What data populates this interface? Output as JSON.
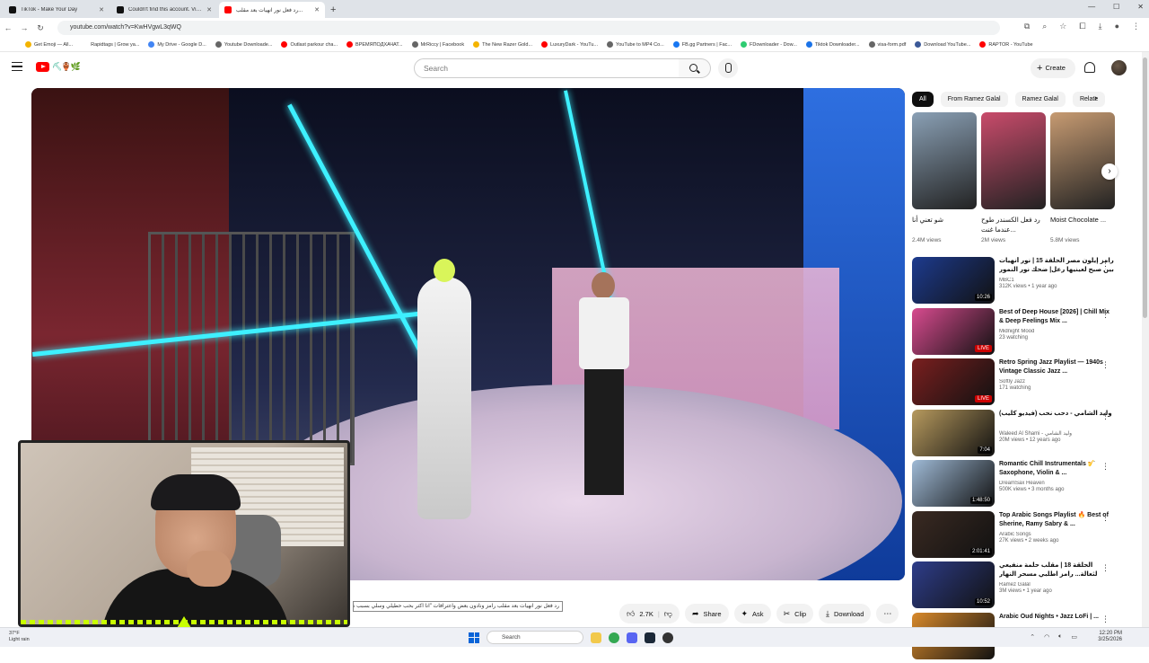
{
  "browser": {
    "tabs": [
      {
        "title": "TikTok - Make Your Day",
        "color": "#111111",
        "active": false
      },
      {
        "title": "Couldn't find this account. Visi...",
        "color": "#111111",
        "active": false
      },
      {
        "title": "رد فعل نور انهيات بعد مقلب...",
        "color": "#ff0000",
        "active": true
      }
    ],
    "url": "youtube.com/watch?v=KwHVgwL3qWQ",
    "bookmarks": [
      {
        "label": "Get Emoji — All...",
        "color": "#f4b400"
      },
      {
        "label": "Rapidtags | Grow ya...",
        "color": "#ffffff"
      },
      {
        "label": "My Drive - Google D...",
        "color": "#4285f4"
      },
      {
        "label": "Youtube Downloade...",
        "color": "#666666"
      },
      {
        "label": "Outlast parkour cha...",
        "color": "#ff0000"
      },
      {
        "label": "ВРЕМЯПОДХАЧАТ...",
        "color": "#ff0000"
      },
      {
        "label": "MrRiccy | Facebook",
        "color": "#666666"
      },
      {
        "label": "The New Razer Gold...",
        "color": "#f4b400"
      },
      {
        "label": "LuxuryDark - YouTu...",
        "color": "#ff0000"
      },
      {
        "label": "YouTube to MP4 Co...",
        "color": "#666666"
      },
      {
        "label": "FB.gg Partners | Fac...",
        "color": "#1877f2"
      },
      {
        "label": "FDownloader - Dow...",
        "color": "#2ecc71"
      },
      {
        "label": "Tiktok Downloader...",
        "color": "#1a73e8"
      },
      {
        "label": "visa-form.pdf",
        "color": "#666666"
      },
      {
        "label": "Download YouTube...",
        "color": "#3b5998"
      },
      {
        "label": "RAPTOR - YouTube",
        "color": "#ff0000"
      }
    ]
  },
  "header": {
    "search_placeholder": "Search",
    "create_label": "Create"
  },
  "video": {
    "caption": "رد فعل نور انهيات بعد مقلب رامز ونادون بعض واعترافات \"انا اكتر بحب حطيلي وسلي بسبب نور لآ\"",
    "actions": {
      "like_count": "2.7K",
      "share": "Share",
      "ask": "Ask",
      "clip": "Clip",
      "download": "Download"
    }
  },
  "chips": [
    "All",
    "From Ramez Galal",
    "Ramez Galal",
    "Relate"
  ],
  "shorts": [
    {
      "title": "شو تعني أنا",
      "views": "2.4M views",
      "color": "#8aa0b5"
    },
    {
      "title": "رد فعل الكسندر طوح عندما غنت...",
      "views": "2M views",
      "color": "#c94b6b"
    },
    {
      "title": "Moist Chocolate ...",
      "views": "5.8M views",
      "color": "#c79b72"
    }
  ],
  "recommendations": [
    {
      "title": "رامز إيلون مصر الحلقة 15 | نور أنهيات بين صبح لعينيها رعل| ضحك نور النمور وكيت",
      "channel": "MBC1",
      "meta": "312K views • 1 year ago",
      "badge": "10:26",
      "badge_type": "duration",
      "color": "#1d3b8f"
    },
    {
      "title": "Best of Deep House [2026] | Chill Mix & Deep Feelings Mix ...",
      "channel": "Midnight Mood",
      "meta": "23 watching",
      "badge": "LIVE",
      "badge_type": "live",
      "color": "#d84b8f"
    },
    {
      "title": "Retro Spring Jazz Playlist — 1940s Vintage Classic Jazz ...",
      "channel": "Softly Jazz",
      "meta": "171 watching",
      "badge": "LIVE",
      "badge_type": "live",
      "color": "#7a1f1f"
    },
    {
      "title": "وليد الشامي - دحب نحب (فيديو كليب)",
      "channel": "Waleed Al Shami - وليد الشامي",
      "meta": "20M views • 12 years ago",
      "badge": "7:04",
      "badge_type": "duration",
      "color": "#b79a5e"
    },
    {
      "title": "Romantic Chill Instrumentals 🎷 Saxophone, Violin & ...",
      "channel": "DreamSax Heaven",
      "meta": "500K views • 3 months ago",
      "badge": "1:48:50",
      "badge_type": "duration",
      "color": "#9fbad6"
    },
    {
      "title": "Top Arabic Songs Playlist 🔥 Best of Sherine, Ramy Sabry & ...",
      "channel": "Arabic Songs",
      "meta": "27K views • 2 weeks ago",
      "badge": "2:01:41",
      "badge_type": "duration",
      "color": "#3a2a22"
    },
    {
      "title": "الحلقة 18 | مقلب حلمة منفيعي لثعالة... رامز اطلبي مسحر النهار مسريع برعلوه الى نمالاته",
      "channel": "Ramez Galal",
      "meta": "3M views • 1 year ago",
      "badge": "10:52",
      "badge_type": "duration",
      "color": "#2e3d8a"
    },
    {
      "title": "Arabic Oud Nights • Jazz LoFi | ...",
      "channel": "",
      "meta": "",
      "badge": "",
      "badge_type": "none",
      "color": "#d98a2b"
    }
  ],
  "taskbar": {
    "weather_temp": "37°F",
    "weather_desc": "Light rain",
    "search_label": "Search",
    "time": "12:20 PM",
    "date": "3/25/2026"
  }
}
